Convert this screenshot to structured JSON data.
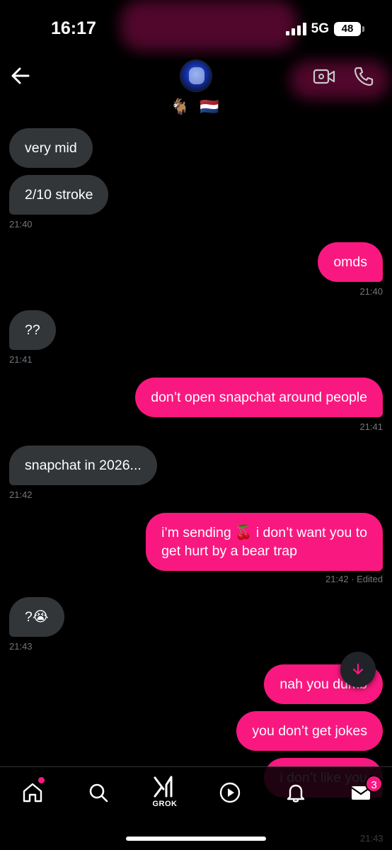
{
  "status_bar": {
    "time": "16:17",
    "network": "5G",
    "battery": "48"
  },
  "header": {
    "name": "🐐 🇳🇱"
  },
  "messages": [
    {
      "text": "very mid",
      "dir": "in"
    },
    {
      "text": "2/10 stroke",
      "dir": "in",
      "time": "21:40"
    },
    {
      "text": "omds",
      "dir": "out",
      "time": "21:40"
    },
    {
      "text": "??",
      "dir": "in",
      "time": "21:41"
    },
    {
      "text": "don’t open snapchat around people",
      "dir": "out",
      "time": "21:41"
    },
    {
      "text": "snapchat in 2026...",
      "dir": "in",
      "time": "21:42"
    },
    {
      "text_line1": "i’m sending 🍒 i don’t want you to",
      "text_line2": "get hurt by a bear trap",
      "dir": "out",
      "time": "21:42 · Edited"
    },
    {
      "text": "?😭",
      "dir": "in",
      "time": "21:43"
    },
    {
      "text": "nah you dumb",
      "dir": "out"
    },
    {
      "text": "you don’t get jokes",
      "dir": "out"
    },
    {
      "text": "i don’t like you",
      "dir": "out",
      "time": "21:43"
    }
  ],
  "nav": {
    "grok_label": "GROK",
    "messages_badge": "3"
  },
  "colors": {
    "accent": "#f91880",
    "incoming_bubble": "#333638",
    "timestamp": "#71767b"
  },
  "icons": [
    "back-arrow-icon",
    "video-call-icon",
    "phone-icon",
    "arrow-down-icon",
    "home-icon",
    "search-icon",
    "grok-icon",
    "play-icon",
    "bell-icon",
    "mail-icon"
  ]
}
